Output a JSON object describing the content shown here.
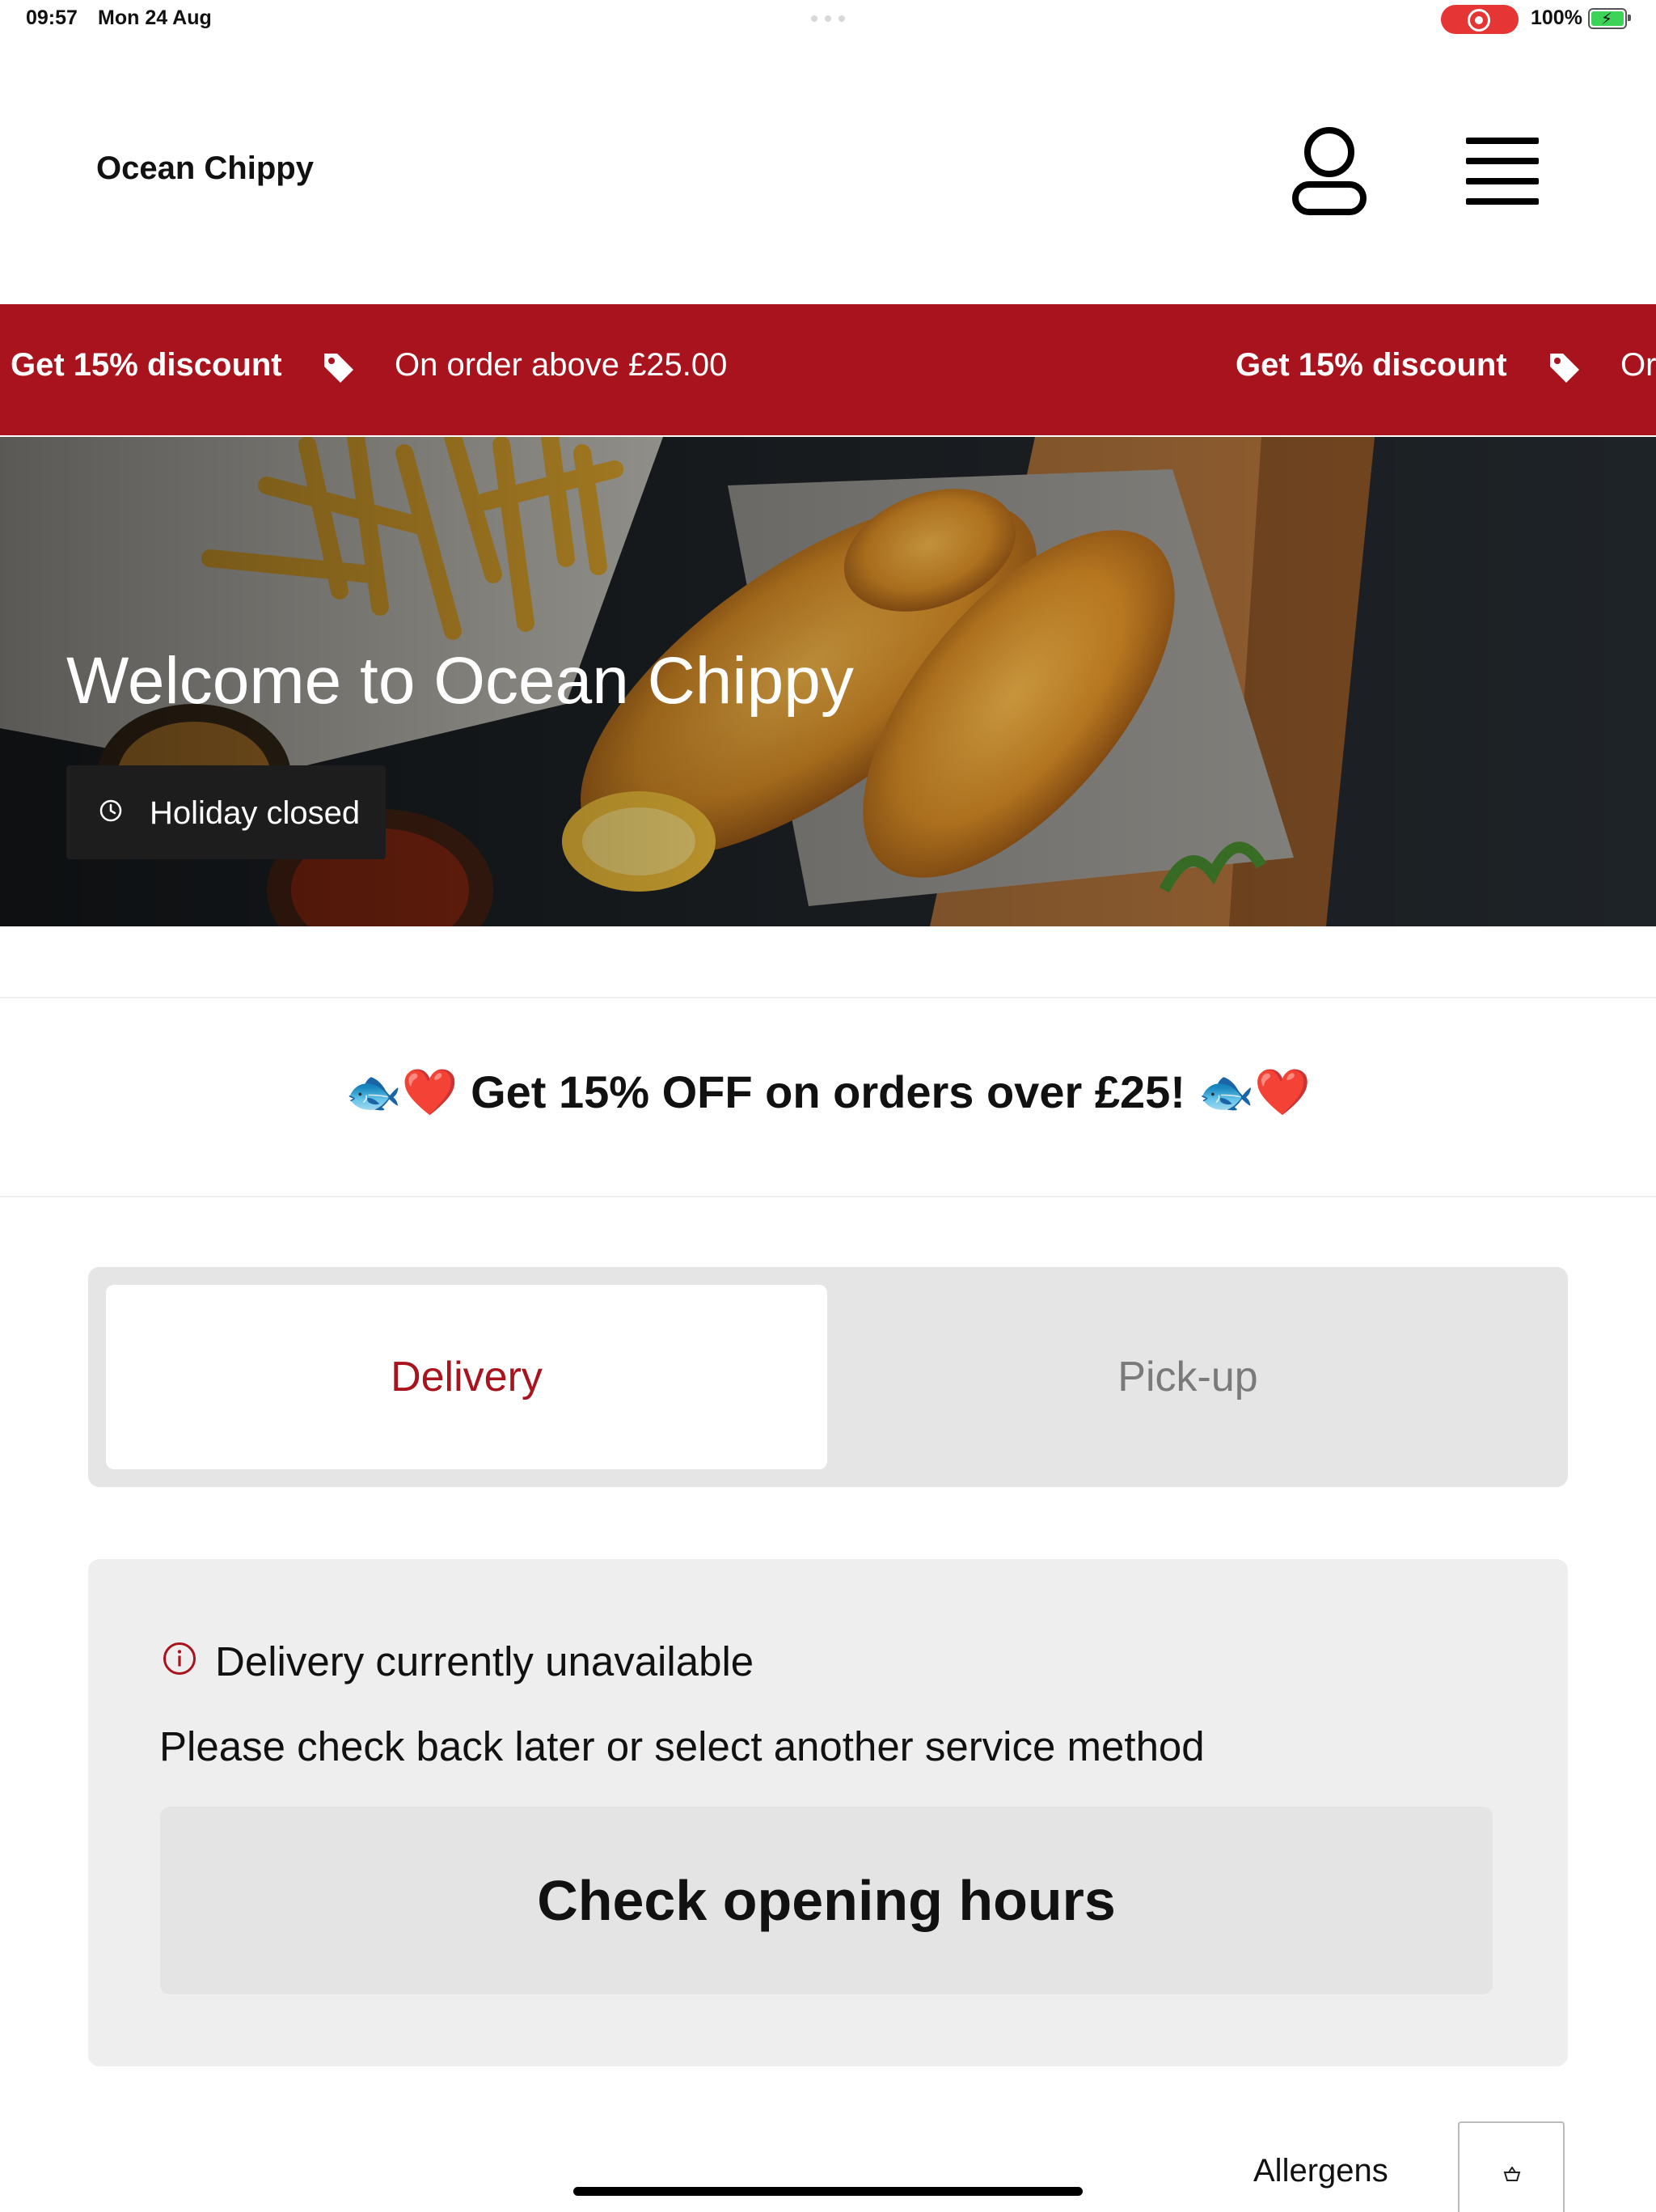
{
  "status_bar": {
    "time": "09:57",
    "date": "Mon 24 Aug",
    "battery": "100%",
    "icons": [
      "multitasking-dots-icon",
      "screen-recording-icon",
      "battery-charging-icon"
    ]
  },
  "header": {
    "brand": "Ocean Chippy",
    "icons": [
      "user-account-icon",
      "hamburger-menu-icon"
    ]
  },
  "promo_band": {
    "headline": "Get 15% discount",
    "detail": "On order above £25.00",
    "detail_cut": "Or",
    "icon": "price-tag-icon",
    "background": "#a9131d"
  },
  "hero": {
    "title": "Welcome to Ocean Chippy",
    "status": "Holiday closed",
    "status_icon": "clock-icon"
  },
  "offer": {
    "text": "🐟❤️ Get 15% OFF on orders over £25! 🐟❤️"
  },
  "service_tabs": {
    "options": [
      "Delivery",
      "Pick-up"
    ],
    "selected": "Delivery",
    "accent": "#a9131d"
  },
  "notice": {
    "title": "Delivery currently unavailable",
    "body": "Please check back later or select another service method",
    "button": "Check opening hours",
    "icon": "info-icon"
  },
  "footer": {
    "allergens": "Allergens",
    "basket_icon": "basket-icon"
  }
}
